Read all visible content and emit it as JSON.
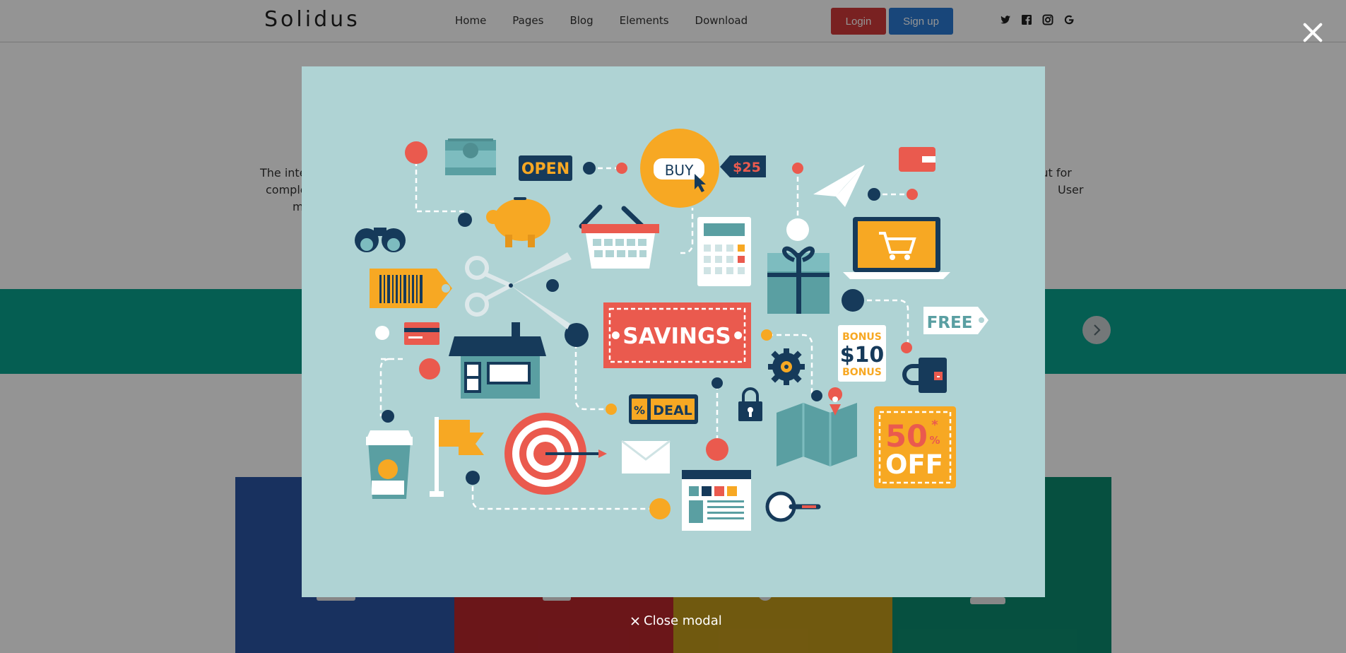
{
  "nav": {
    "brand": "Solidus",
    "links": [
      "Home",
      "Pages",
      "Blog",
      "Elements",
      "Download"
    ],
    "login": "Login",
    "signup": "Sign up",
    "social_icons": [
      "twitter-icon",
      "facebook-icon",
      "instagram-icon",
      "google-icon"
    ]
  },
  "intro": {
    "line1_left": "The inte",
    "line1_right": "h but for",
    "line2_left": "comple",
    "line2_right": "User",
    "line3_left": "m"
  },
  "tiles": {
    "colors": [
      "#2a55a4",
      "#b8262c",
      "#c29a1b",
      "#0c8b6f"
    ]
  },
  "modal": {
    "close_label": "Close modal",
    "image": {
      "background": "#afd3d4",
      "texts": {
        "open": "OPEN",
        "buy": "BUY",
        "price": "$25",
        "savings": "•SAVINGS•",
        "free": "FREE",
        "bonus_top": "BONUS",
        "bonus_amount": "$10",
        "bonus_bottom": "BONUS",
        "deal_pct": "%",
        "deal": "DEAL",
        "off_pct": "50",
        "off_sign": "%",
        "off": "OFF",
        "star": "*"
      }
    }
  },
  "colors": {
    "login": "#d03a3a",
    "signup": "#2a79d3",
    "teal": "#0aa38d",
    "navy": "#163a5a",
    "coral": "#ea5a4e",
    "orange": "#f7a823"
  }
}
